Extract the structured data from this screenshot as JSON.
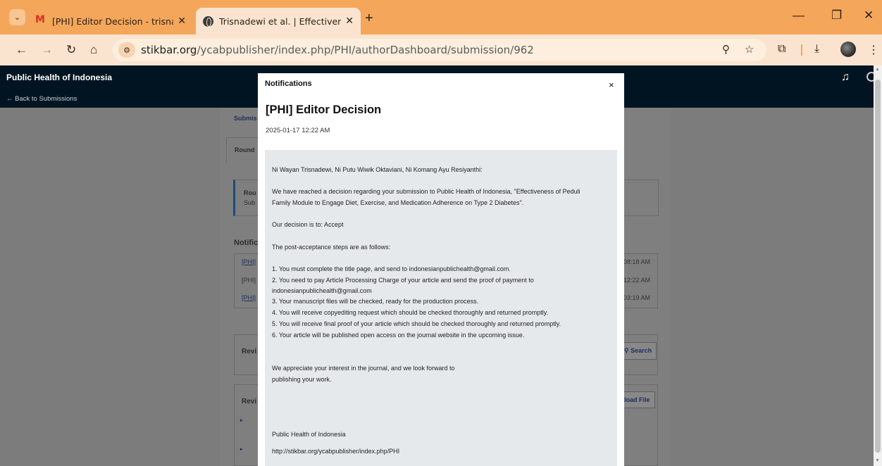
{
  "browser": {
    "tabs": [
      {
        "title": "[PHI] Editor Decision - trisnawi",
        "icon": "gmail-icon"
      },
      {
        "title": "Trisnadewi et al. | Effectiveness",
        "icon": "globe-icon"
      }
    ],
    "url_host": "stikbar.org",
    "url_path": "/ycabpublisher/index.php/PHI/authorDashboard/submission/962"
  },
  "site": {
    "name": "Public Health of Indonesia",
    "back_link": "← Back to Submissions"
  },
  "background": {
    "submission_tab": "Submis",
    "round_tab": "Round",
    "round_box_title": "Rou",
    "round_box_sub": "Sub",
    "notifications_heading": "Notific",
    "notif_rows": [
      {
        "link": "[PHI]",
        "time": "08:18 AM"
      },
      {
        "link": "[PHI]",
        "time": "12:22 AM"
      },
      {
        "link": "[PHI]",
        "time": "03:19 AM"
      }
    ],
    "review_heading_1": "Revi",
    "search_button": "Search",
    "review_heading_2": "Revi",
    "upload_button": "load File"
  },
  "modal": {
    "header": "Notifications",
    "close": "×",
    "title": "[PHI] Editor Decision",
    "date": "2025-01-17 12:22 AM",
    "lines": [
      "Ni Wayan Trisnadewi, Ni Putu Wiwik Oktaviani, Ni Komang Ayu Resiyanthi:",
      "We have reached a decision regarding your submission to Public Health of Indonesia, \"Effectiveness of Peduli",
      "Family Module to Engage Diet, Exercise, and Medication Adherence on Type 2 Diabetes\".",
      "Our decision is to: Accept",
      "The post-acceptance steps are as follows:",
      "1. You must complete the title page, and send to indonesianpublichealth@gmail.com.",
      "2. You need to pay Article Processing Charge of your article and send the proof of payment to",
      "indonesianpublichealth@gmail.com",
      "3. Your manuscript files will be checked, ready for the production process.",
      "4. You will receive copyediting request which should be checked thoroughly and returned promptly.",
      "5. You will receive final proof of your article which should be checked thoroughly and returned promptly.",
      "6. Your article will be published open access on the journal website in the upcoming issue.",
      "We appreciate your interest in the journal, and we look forward to",
      "publishing your work.",
      "Public Health of Indonesia",
      "http://stikbar.org/ycabpublisher/index.php/PHI"
    ]
  }
}
